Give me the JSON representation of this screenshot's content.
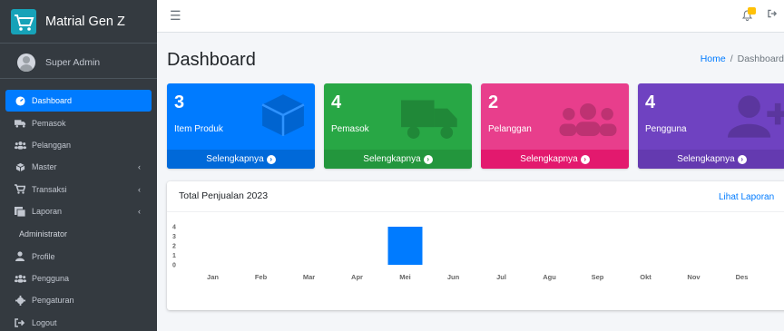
{
  "brand": {
    "name": "Matrial Gen Z"
  },
  "user": {
    "name": "Super Admin"
  },
  "sidebar": {
    "items": [
      {
        "label": "Dashboard",
        "icon": "tachometer-icon",
        "active": true,
        "caret": false
      },
      {
        "label": "Pemasok",
        "icon": "truck-icon",
        "active": false,
        "caret": false
      },
      {
        "label": "Pelanggan",
        "icon": "users-icon",
        "active": false,
        "caret": false
      },
      {
        "label": "Master",
        "icon": "cube-icon",
        "active": false,
        "caret": true
      },
      {
        "label": "Transaksi",
        "icon": "cart-icon",
        "active": false,
        "caret": true
      },
      {
        "label": "Laporan",
        "icon": "report-icon",
        "active": false,
        "caret": true
      }
    ],
    "section_header": "Administrator",
    "admin_items": [
      {
        "label": "Profile",
        "icon": "user-icon"
      },
      {
        "label": "Pengguna",
        "icon": "users-icon"
      },
      {
        "label": "Pengaturan",
        "icon": "cog-icon"
      },
      {
        "label": "Logout",
        "icon": "sign-out-icon"
      }
    ]
  },
  "topbar": {
    "menu_icon": "hamburger-icon",
    "notif_icon": "bell-icon",
    "logout_icon": "sign-out-icon"
  },
  "page": {
    "title": "Dashboard"
  },
  "breadcrumb": {
    "home": "Home",
    "separator": "/",
    "current": "Dashboard"
  },
  "boxes": [
    {
      "count": "3",
      "label": "Item Produk",
      "footer": "Selengkapnya",
      "icon": "cube-icon",
      "color": "#007bff",
      "footer_color": "#0069d9"
    },
    {
      "count": "4",
      "label": "Pemasok",
      "footer": "Selengkapnya",
      "icon": "truck-icon",
      "color": "#28a745",
      "footer_color": "#23963d"
    },
    {
      "count": "2",
      "label": "Pelanggan",
      "footer": "Selengkapnya",
      "icon": "users-icon",
      "color": "#e83e8c",
      "footer_color": "#e3196e"
    },
    {
      "count": "4",
      "label": "Pengguna",
      "footer": "Selengkapnya",
      "icon": "user-plus-icon",
      "color": "#6f42c1",
      "footer_color": "#643ab0"
    }
  ],
  "sales_card": {
    "title": "Total Penjualan 2023",
    "link": "Lihat Laporan"
  },
  "chart_data": {
    "type": "bar",
    "title": "Total Penjualan 2023",
    "categories": [
      "Jan",
      "Feb",
      "Mar",
      "Apr",
      "Mei",
      "Jun",
      "Jul",
      "Agu",
      "Sep",
      "Okt",
      "Nov",
      "Des"
    ],
    "values": [
      0,
      0,
      0,
      0,
      4,
      0,
      0,
      0,
      0,
      0,
      0,
      0
    ],
    "yticks": [
      "4",
      "3",
      "2",
      "1",
      "0"
    ],
    "ylim": [
      0,
      4
    ],
    "bar_color": "#007bff",
    "grid": false,
    "legend": "none"
  }
}
